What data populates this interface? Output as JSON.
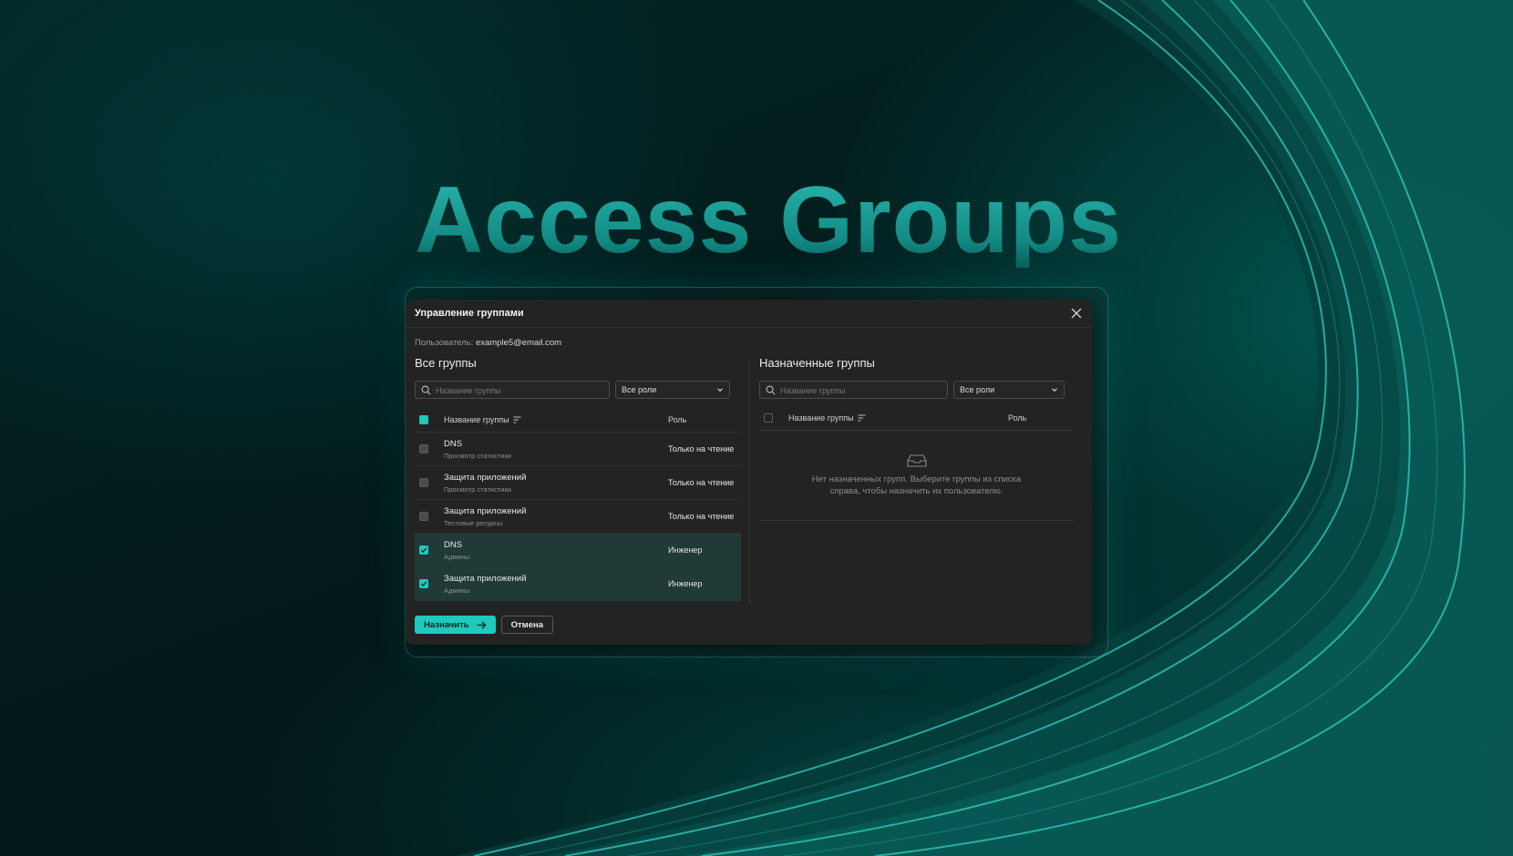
{
  "hero": {
    "title": "Access Groups"
  },
  "modal": {
    "title": "Управление группами",
    "user_label": "Пользователь:",
    "user_email": "example5@email.com"
  },
  "left": {
    "title": "Все группы",
    "search_placeholder": "Название группы",
    "filter_value": "Все роли",
    "col_name": "Название группы",
    "col_role": "Роль",
    "rows": [
      {
        "name": "DNS",
        "sub": "Просмотр статистики",
        "role": "Только на чтение",
        "checked": false
      },
      {
        "name": "Защита приложений",
        "sub": "Просмотр статистики",
        "role": "Только на чтение",
        "checked": false
      },
      {
        "name": "Защита приложений",
        "sub": "Тестовые ресурсы",
        "role": "Только на чтение",
        "checked": false
      },
      {
        "name": "DNS",
        "sub": "Админы",
        "role": "Инженер",
        "checked": true
      },
      {
        "name": "Защита приложений",
        "sub": "Админы",
        "role": "Инженер",
        "checked": true
      }
    ]
  },
  "right": {
    "title": "Назначенные группы",
    "search_placeholder": "Название группы",
    "filter_value": "Все роли",
    "col_name": "Название группы",
    "col_role": "Роль",
    "empty_text": "Нет назначенных групп. Выберите группы из списка справа, чтобы назначить их пользователю."
  },
  "footer": {
    "assign_label": "Назначить",
    "cancel_label": "Отмена"
  },
  "colors": {
    "accent": "#1ec9bd",
    "modal_bg": "#232323",
    "selected_row": "#1f3a37"
  },
  "icons": [
    "close-icon",
    "search-icon",
    "chevron-down-icon",
    "sort-icon",
    "check-icon",
    "inbox-icon",
    "arrow-right-icon"
  ]
}
